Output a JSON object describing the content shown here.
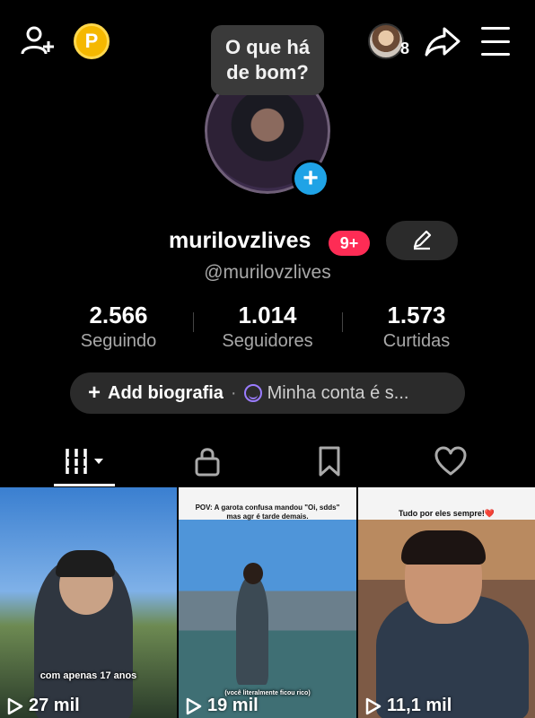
{
  "topbar": {
    "add_user_icon": "add-user-icon",
    "coin_label": "P",
    "avatar_count": "8",
    "share_icon": "share-arrow-icon",
    "menu_icon": "hamburger-menu-icon"
  },
  "tooltip": {
    "text": "O que há\nde bom?"
  },
  "profile": {
    "username": "murilovzlives",
    "notification_badge": "9+",
    "handle": "@murilovzlives",
    "edit_icon": "pencil-icon"
  },
  "stats": [
    {
      "value": "2.566",
      "label": "Seguindo"
    },
    {
      "value": "1.014",
      "label": "Seguidores"
    },
    {
      "value": "1.573",
      "label": "Curtidas"
    }
  ],
  "bio": {
    "add_label": "Add biografia",
    "separator": "·",
    "account_text": "Minha conta é s..."
  },
  "tabs": [
    {
      "icon": "grid-videos-icon",
      "active": true
    },
    {
      "icon": "lock-icon",
      "active": false
    },
    {
      "icon": "bookmark-icon",
      "active": false
    },
    {
      "icon": "heart-icon",
      "active": false
    }
  ],
  "videos": [
    {
      "caption": "",
      "overlay": "com apenas 17 anos",
      "views": "27 mil"
    },
    {
      "caption": "POV: A garota confusa mandou \"Oi, sdds\" mas agr é tarde demais.",
      "overlay": "(você literalmente ficou rico)",
      "views": "19 mil"
    },
    {
      "caption": "Tudo por eles sempre!❤️",
      "overlay": "",
      "views": "11,1 mil"
    }
  ],
  "colors": {
    "background": "#000000",
    "accent_pink": "#fe2c55",
    "accent_blue": "#1fa3e6",
    "coin_gold": "#f5b800",
    "pill_bg": "#2b2b2b"
  }
}
